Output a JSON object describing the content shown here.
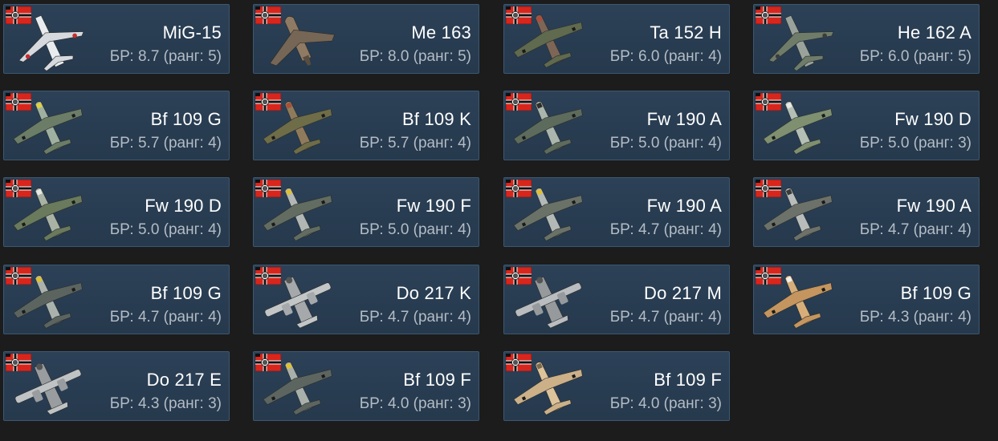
{
  "vehicles": [
    {
      "name": "MiG-15",
      "br": "БР: 8.7 (ранг: 5)",
      "nation_icon": "german-flag-icon",
      "icon": "jet-fighter-icon",
      "fuselage": "#e9ecee",
      "wing": "#d6dadf",
      "accent": "#cc2b2b"
    },
    {
      "name": "Me 163",
      "br": "БР: 8.0 (ранг: 5)",
      "nation_icon": "german-flag-icon",
      "icon": "rocket-fighter-icon",
      "fuselage": "#8f7a63",
      "wing": "#766655",
      "accent": "#5a4d3f"
    },
    {
      "name": "Ta 152 H",
      "br": "БР: 6.0 (ранг: 4)",
      "nation_icon": "german-flag-icon",
      "icon": "fighter-plane-icon",
      "fuselage": "#7d6656",
      "wing": "#5f6a4e",
      "accent": "#b24a3c"
    },
    {
      "name": "He 162 A",
      "br": "БР: 6.0 (ранг: 5)",
      "nation_icon": "german-flag-icon",
      "icon": "jet-fighter-icon",
      "fuselage": "#9aa39b",
      "wing": "#6f7c6a",
      "accent": "#3c3c3c"
    },
    {
      "name": "Bf 109 G",
      "br": "БР: 5.7 (ранг: 4)",
      "nation_icon": "german-flag-icon",
      "icon": "fighter-plane-icon",
      "fuselage": "#9fb0a0",
      "wing": "#6b7d66",
      "accent": "#e0d040"
    },
    {
      "name": "Bf 109 K",
      "br": "БР: 5.7 (ранг: 4)",
      "nation_icon": "german-flag-icon",
      "icon": "fighter-plane-icon",
      "fuselage": "#8f7b5c",
      "wing": "#6e6d48",
      "accent": "#a8503a"
    },
    {
      "name": "Fw 190 A",
      "br": "БР: 5.0 (ранг: 4)",
      "nation_icon": "german-flag-icon",
      "icon": "fighter-plane-icon",
      "fuselage": "#aab5ad",
      "wing": "#5d6b5c",
      "accent": "#2e2e2e"
    },
    {
      "name": "Fw 190 D",
      "br": "БР: 5.0 (ранг: 3)",
      "nation_icon": "german-flag-icon",
      "icon": "fighter-plane-icon",
      "fuselage": "#b4bfb5",
      "wing": "#7e9070",
      "accent": "#e8e8e8"
    },
    {
      "name": "Fw 190 D",
      "br": "БР: 5.0 (ранг: 4)",
      "nation_icon": "german-flag-icon",
      "icon": "fighter-plane-icon",
      "fuselage": "#a9b3a5",
      "wing": "#6a7a5c",
      "accent": "#e8e8e8"
    },
    {
      "name": "Fw 190 F",
      "br": "БР: 5.0 (ранг: 4)",
      "nation_icon": "german-flag-icon",
      "icon": "fighter-plane-icon",
      "fuselage": "#b1b7b4",
      "wing": "#626c61",
      "accent": "#e0c030"
    },
    {
      "name": "Fw 190 A",
      "br": "БР: 4.7 (ранг: 4)",
      "nation_icon": "german-flag-icon",
      "icon": "fighter-plane-icon",
      "fuselage": "#b3b9b6",
      "wing": "#6a7268",
      "accent": "#e0c030"
    },
    {
      "name": "Fw 190 A",
      "br": "БР: 4.7 (ранг: 4)",
      "nation_icon": "german-flag-icon",
      "icon": "fighter-plane-icon",
      "fuselage": "#b8bdbb",
      "wing": "#6c726a",
      "accent": "#3a3a3a"
    },
    {
      "name": "Bf 109 G",
      "br": "БР: 4.7 (ранг: 4)",
      "nation_icon": "german-flag-icon",
      "icon": "fighter-plane-icon",
      "fuselage": "#aab2ad",
      "wing": "#5c6460",
      "accent": "#e0c030"
    },
    {
      "name": "Do 217 K",
      "br": "БР: 4.7 (ранг: 4)",
      "nation_icon": "german-flag-icon",
      "icon": "bomber-plane-icon",
      "fuselage": "#c3c6c7",
      "wing": "#a5a9ab",
      "accent": "#555555"
    },
    {
      "name": "Do 217 M",
      "br": "БР: 4.7 (ранг: 4)",
      "nation_icon": "german-flag-icon",
      "icon": "bomber-plane-icon",
      "fuselage": "#b9bdbf",
      "wing": "#969a9c",
      "accent": "#555555"
    },
    {
      "name": "Bf 109 G",
      "br": "БР: 4.3 (ранг: 4)",
      "nation_icon": "german-flag-icon",
      "icon": "fighter-plane-icon",
      "fuselage": "#d7ae7a",
      "wing": "#c4955e",
      "accent": "#f0f0f0"
    },
    {
      "name": "Do 217 E",
      "br": "БР: 4.3 (ранг: 3)",
      "nation_icon": "german-flag-icon",
      "icon": "bomber-plane-icon",
      "fuselage": "#bfc3c4",
      "wing": "#999d9f",
      "accent": "#555555"
    },
    {
      "name": "Bf 109 F",
      "br": "БР: 4.0 (ранг: 3)",
      "nation_icon": "german-flag-icon",
      "icon": "fighter-plane-icon",
      "fuselage": "#a9b0ab",
      "wing": "#5d6560",
      "accent": "#e0c030"
    },
    {
      "name": "Bf 109 F",
      "br": "БР: 4.0 (ранг: 3)",
      "nation_icon": "german-flag-icon",
      "icon": "fighter-plane-icon",
      "fuselage": "#dcc39a",
      "wing": "#cbb088",
      "accent": "#7a6a50"
    }
  ],
  "colors": {
    "card_bg": "#2c4157",
    "card_border": "#3c5872",
    "page_bg": "#1c1c1c",
    "name_text": "#ffffff",
    "br_text": "#b4bcc5"
  }
}
